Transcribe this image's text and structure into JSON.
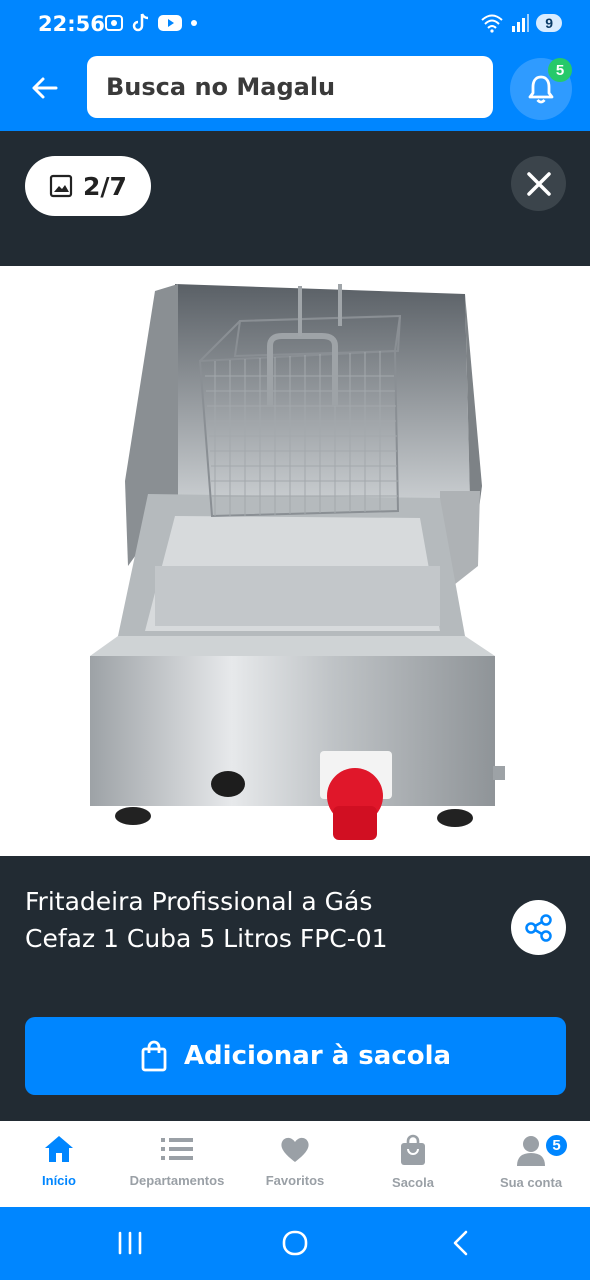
{
  "status": {
    "time": "22:56",
    "battery": "9"
  },
  "header": {
    "search_placeholder": "Busca no Magalu",
    "notifications_count": "5"
  },
  "viewer": {
    "image_counter": "2/7",
    "product_title_line1": "Fritadeira Profissional a Gás",
    "product_title_line2": "Cefaz 1 Cuba 5 Litros FPC-01",
    "add_button_label": "Adicionar à sacola"
  },
  "bottom_nav": {
    "items": [
      {
        "label": "Início",
        "icon": "home-icon",
        "active": true
      },
      {
        "label": "Departamentos",
        "icon": "list-icon",
        "active": false
      },
      {
        "label": "Favoritos",
        "icon": "heart-icon",
        "active": false
      },
      {
        "label": "Sacola",
        "icon": "bag-icon",
        "active": false
      },
      {
        "label": "Sua conta",
        "icon": "user-icon",
        "active": false
      }
    ],
    "account_badge": "5"
  },
  "colors": {
    "brand_blue": "#0086ff",
    "viewer_bg": "#222b33",
    "badge_green": "#26c96a"
  }
}
